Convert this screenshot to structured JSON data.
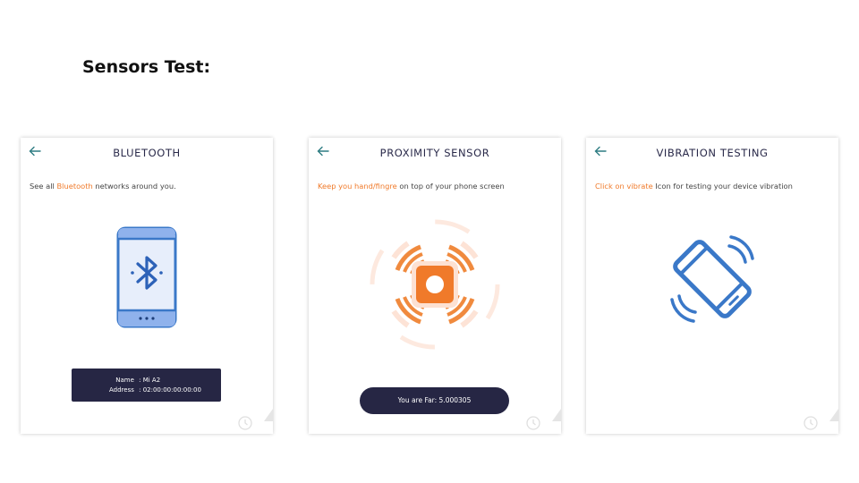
{
  "slide": {
    "title": "Sensors Test:"
  },
  "cards": [
    {
      "title": "BLUETOOTH",
      "desc_pre": "See all ",
      "desc_hl": "Bluetooth",
      "desc_post": " networks around you.",
      "info_name_label": "Name",
      "info_name_value": ": Mi A2",
      "info_address_label": "Address",
      "info_address_value": ": 02:00:00:00:00:00",
      "icon": "bluetooth-phone-icon"
    },
    {
      "title": "PROXIMITY SENSOR",
      "desc_hl": "Keep you hand/fingre",
      "desc_post": " on top of your phone screen",
      "status": "You are Far: 5.000305",
      "icon": "proximity-waves-icon"
    },
    {
      "title": "VIBRATION TESTING",
      "desc_hl": "Click on vibrate",
      "desc_post": " Icon for testing your device vibration",
      "icon": "vibrating-phone-icon"
    }
  ],
  "colors": {
    "accent": "#f07a2a",
    "blue": "#3a78c8",
    "dark": "#262644",
    "teal": "#2d7c82"
  }
}
